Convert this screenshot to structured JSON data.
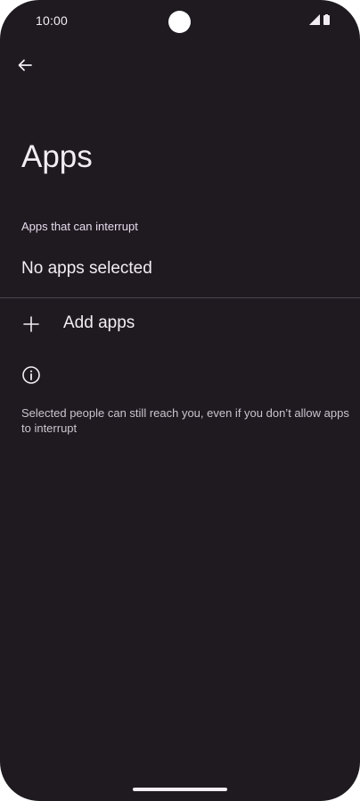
{
  "status_bar": {
    "time": "10:00",
    "signal_icon": "signal-icon",
    "battery_icon": "battery-icon"
  },
  "header": {
    "back_icon": "arrow-back-icon",
    "title": "Apps"
  },
  "section": {
    "header": "Apps that can interrupt",
    "empty_text": "No apps selected"
  },
  "actions": {
    "add_icon": "plus-icon",
    "add_label": "Add apps"
  },
  "info": {
    "icon": "info-icon",
    "text": "Selected people can still reach you, even if you don’t allow apps to interrupt"
  },
  "colors": {
    "background": "#1e1a20",
    "text_primary": "#f1edf3",
    "text_secondary": "#cbc4cf",
    "divider": "#4a454d"
  }
}
